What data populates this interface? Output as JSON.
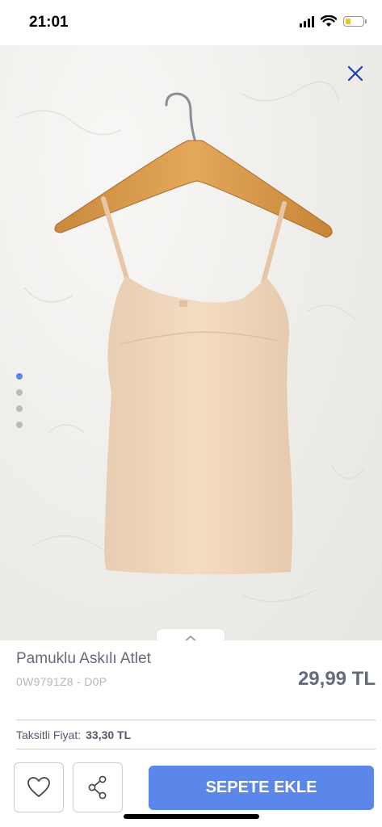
{
  "status_bar": {
    "time": "21:01",
    "icons": [
      "signal-icon",
      "wifi-icon",
      "battery-icon"
    ],
    "battery_level": 0.3
  },
  "gallery": {
    "image_count": 4,
    "active_index": 0,
    "close_icon": "close-icon",
    "expand_icon": "chevron-up-icon",
    "accent": "#5b86e5"
  },
  "product": {
    "title": "Pamuklu Askılı Atlet",
    "sku": "0W9791Z8 - D0P",
    "price": "29,99 TL"
  },
  "installment": {
    "label": "Taksitli Fiyat:",
    "value": "33,30 TL"
  },
  "actions": {
    "favorite_icon": "heart-icon",
    "share_icon": "share-icon",
    "add_to_cart_label": "SEPETE EKLE",
    "button_color": "#5b86ea"
  }
}
